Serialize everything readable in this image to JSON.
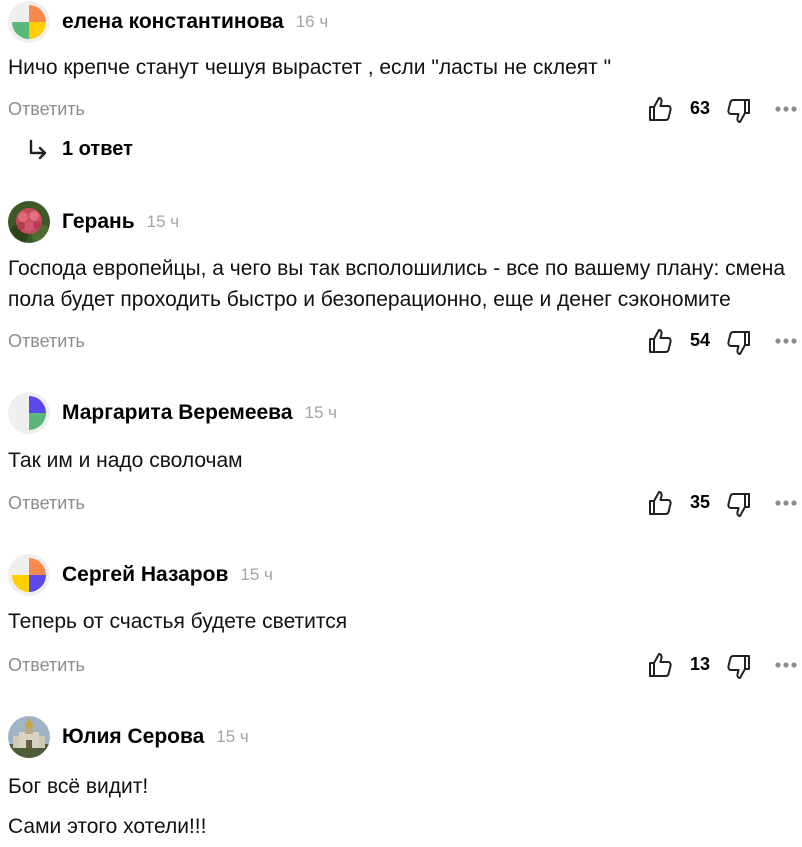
{
  "comments": [
    {
      "author": "елена константинова",
      "time": "16 ч",
      "lines": [
        "Ничо крепче станут чешуя вырастет , если \"ласты не склеят \""
      ],
      "reply_label": "Ответить",
      "likes": "63",
      "avatar": "four-leaf-orange-green-yellow"
    },
    {
      "author": "Герань",
      "time": "15 ч",
      "lines": [
        "Господа европейцы, а чего вы так всполошились - все по вашему плану: смена",
        "пола будет проходить быстро и безоперационно, еще и денег сэкономите"
      ],
      "reply_label": "Ответить",
      "likes": "54",
      "avatar": "geranium-flower-photo"
    },
    {
      "author": "Маргарита Веремеева",
      "time": "15 ч",
      "lines": [
        "Так им и надо сволочам"
      ],
      "reply_label": "Ответить",
      "likes": "35",
      "avatar": "four-leaf-purple-green"
    },
    {
      "author": "Сергей Назаров",
      "time": "15 ч",
      "lines": [
        "Теперь от счастья будете светится"
      ],
      "reply_label": "Ответить",
      "likes": "13",
      "avatar": "four-leaf-orange-yellow-purple"
    },
    {
      "author": "Юлия Серова",
      "time": "15 ч",
      "lines": [
        "Бог всё видит!",
        "Сами этого хотели!!!"
      ],
      "avatar": "church-photo"
    }
  ],
  "replies_toggle": {
    "label": "1 ответ",
    "icon": "reply-arrow-icon"
  },
  "colors": {
    "muted": "#8c8c8c",
    "time": "#a3a3a3",
    "leaf_orange": "#f7894a",
    "leaf_green": "#5cb878",
    "leaf_yellow": "#ffcd00",
    "leaf_purple": "#5b48e8"
  }
}
